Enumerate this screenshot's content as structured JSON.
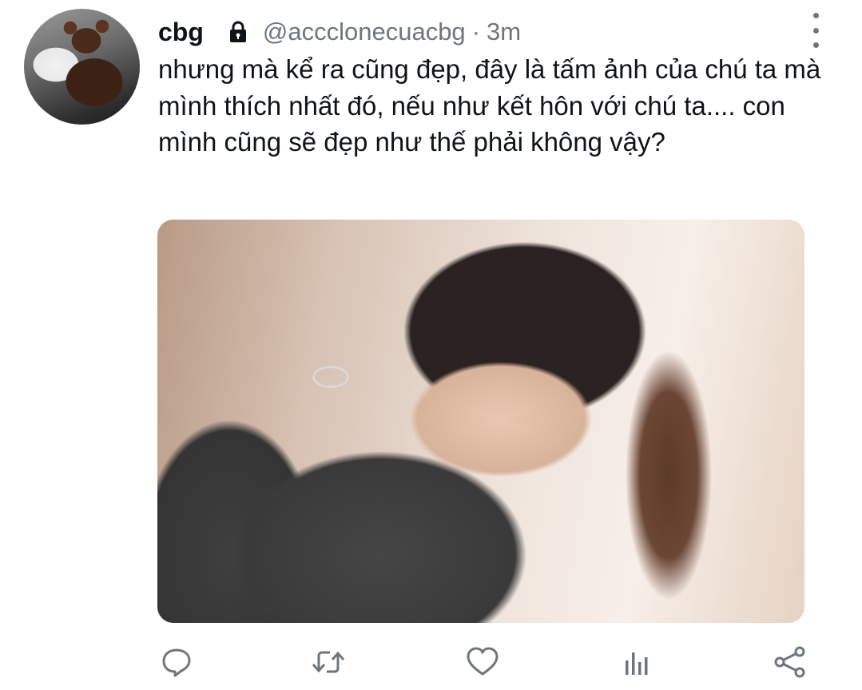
{
  "tweet": {
    "display_name": "cbg",
    "handle": "@accclonecuacbg",
    "separator": "·",
    "time": "3m",
    "text": "nhưng mà kể ra cũng đẹp, đây là tấm ảnh của chú ta mà mình thích nhất đó, nếu như kết hôn với chú ta.... con mình cũng sẽ đẹp như thế phải không vậy?",
    "protected_icon": "lock-icon",
    "more_icon": "more-vertical-icon"
  },
  "actions": [
    {
      "name": "reply",
      "icon": "reply-icon"
    },
    {
      "name": "retweet",
      "icon": "retweet-icon"
    },
    {
      "name": "like",
      "icon": "heart-icon"
    },
    {
      "name": "analytics",
      "icon": "analytics-icon"
    },
    {
      "name": "share",
      "icon": "share-icon"
    }
  ],
  "colors": {
    "text": "#0f1419",
    "secondary": "#6e767d",
    "background": "#ffffff"
  }
}
